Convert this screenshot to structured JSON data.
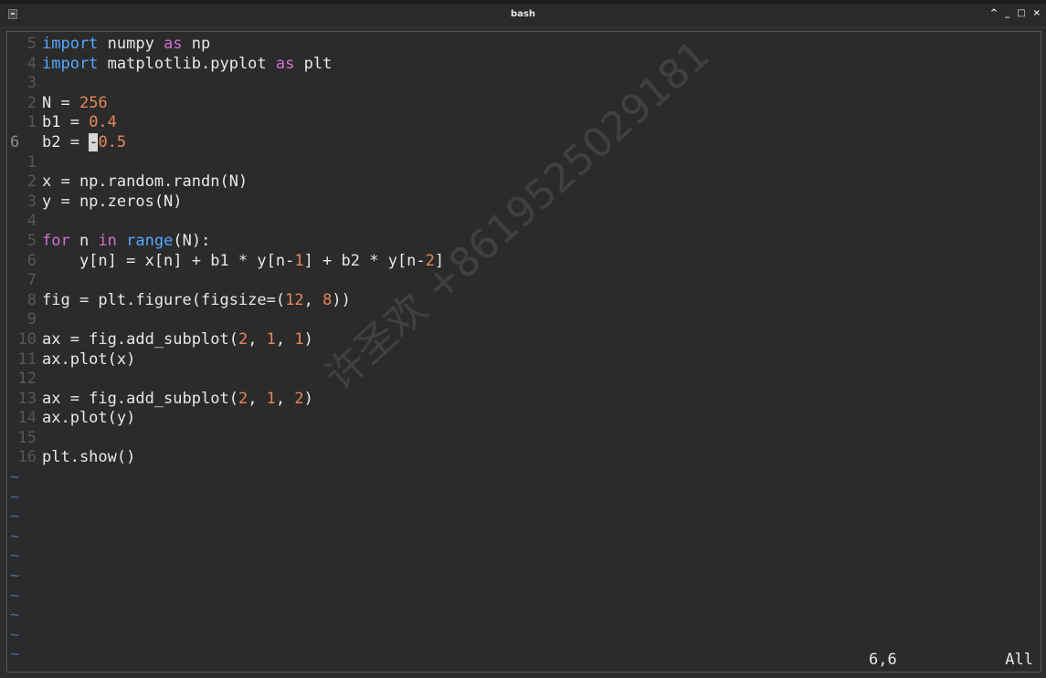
{
  "window": {
    "title": "bash",
    "controls": {
      "up": "^",
      "minimize": "_",
      "maximize": "□",
      "close": "×"
    }
  },
  "editor": {
    "lines": [
      {
        "ln": "5",
        "tokens": [
          {
            "t": "import",
            "c": "kw"
          },
          {
            "t": " numpy ",
            "c": ""
          },
          {
            "t": "as",
            "c": "kw2"
          },
          {
            "t": " np",
            "c": ""
          }
        ]
      },
      {
        "ln": "4",
        "tokens": [
          {
            "t": "import",
            "c": "kw"
          },
          {
            "t": " matplotlib.pyplot ",
            "c": ""
          },
          {
            "t": "as",
            "c": "kw2"
          },
          {
            "t": " plt",
            "c": ""
          }
        ]
      },
      {
        "ln": "3",
        "tokens": []
      },
      {
        "ln": "2",
        "tokens": [
          {
            "t": "N = ",
            "c": ""
          },
          {
            "t": "256",
            "c": "num"
          }
        ]
      },
      {
        "ln": "1",
        "tokens": [
          {
            "t": "b1 = ",
            "c": ""
          },
          {
            "t": "0.4",
            "c": "num"
          }
        ]
      },
      {
        "ln": "6",
        "current": true,
        "tokens": [
          {
            "t": "b2 = ",
            "c": ""
          },
          {
            "t": "-",
            "c": "cursor"
          },
          {
            "t": "0.5",
            "c": "num"
          }
        ]
      },
      {
        "ln": "1",
        "tokens": []
      },
      {
        "ln": "2",
        "tokens": [
          {
            "t": "x = np.random.randn(N)",
            "c": ""
          }
        ]
      },
      {
        "ln": "3",
        "tokens": [
          {
            "t": "y = np.zeros(N)",
            "c": ""
          }
        ]
      },
      {
        "ln": "4",
        "tokens": []
      },
      {
        "ln": "5",
        "tokens": [
          {
            "t": "for",
            "c": "kw2"
          },
          {
            "t": " n ",
            "c": ""
          },
          {
            "t": "in",
            "c": "kw2"
          },
          {
            "t": " ",
            "c": ""
          },
          {
            "t": "range",
            "c": "kw"
          },
          {
            "t": "(N):",
            "c": ""
          }
        ]
      },
      {
        "ln": "6",
        "tokens": [
          {
            "t": "    y[n] = x[n] + b1 * y[n-",
            "c": ""
          },
          {
            "t": "1",
            "c": "num"
          },
          {
            "t": "] + b2 * y[n-",
            "c": ""
          },
          {
            "t": "2",
            "c": "num"
          },
          {
            "t": "]",
            "c": ""
          }
        ]
      },
      {
        "ln": "7",
        "tokens": []
      },
      {
        "ln": "8",
        "tokens": [
          {
            "t": "fig = plt.figure(figsize=(",
            "c": ""
          },
          {
            "t": "12",
            "c": "num"
          },
          {
            "t": ", ",
            "c": ""
          },
          {
            "t": "8",
            "c": "num"
          },
          {
            "t": "))",
            "c": ""
          }
        ]
      },
      {
        "ln": "9",
        "tokens": []
      },
      {
        "ln": "10",
        "tokens": [
          {
            "t": "ax = fig.add_subplot(",
            "c": ""
          },
          {
            "t": "2",
            "c": "num"
          },
          {
            "t": ", ",
            "c": ""
          },
          {
            "t": "1",
            "c": "num"
          },
          {
            "t": ", ",
            "c": ""
          },
          {
            "t": "1",
            "c": "num"
          },
          {
            "t": ")",
            "c": ""
          }
        ]
      },
      {
        "ln": "11",
        "tokens": [
          {
            "t": "ax.plot(x)",
            "c": ""
          }
        ]
      },
      {
        "ln": "12",
        "tokens": []
      },
      {
        "ln": "13",
        "tokens": [
          {
            "t": "ax = fig.add_subplot(",
            "c": ""
          },
          {
            "t": "2",
            "c": "num"
          },
          {
            "t": ", ",
            "c": ""
          },
          {
            "t": "1",
            "c": "num"
          },
          {
            "t": ", ",
            "c": ""
          },
          {
            "t": "2",
            "c": "num"
          },
          {
            "t": ")",
            "c": ""
          }
        ]
      },
      {
        "ln": "14",
        "tokens": [
          {
            "t": "ax.plot(y)",
            "c": ""
          }
        ]
      },
      {
        "ln": "15",
        "tokens": []
      },
      {
        "ln": "16",
        "tokens": [
          {
            "t": "plt.show()",
            "c": ""
          }
        ]
      }
    ],
    "empty_marker": "~",
    "empty_lines": 10
  },
  "status": {
    "position": "6,6",
    "scroll": "All"
  },
  "watermark": "许圣欢 +8619525029181"
}
